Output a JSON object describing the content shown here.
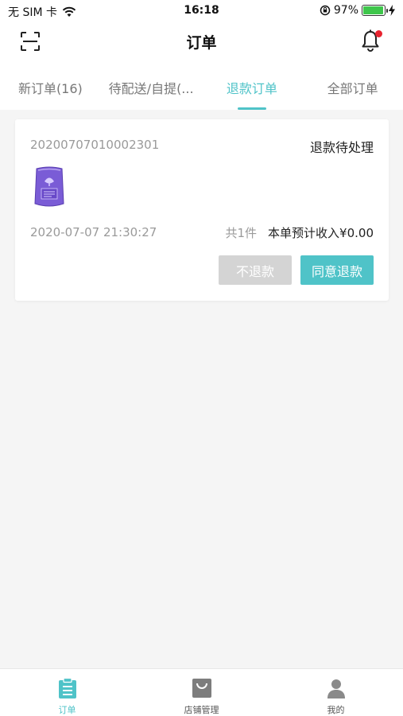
{
  "status_bar": {
    "carrier": "无 SIM 卡",
    "time": "16:18",
    "battery_percent_label": "97%",
    "battery_level": 0.97
  },
  "navbar": {
    "title": "订单"
  },
  "tabs": [
    {
      "label": "新订单(16)",
      "active": false
    },
    {
      "label": "待配送/自提(...",
      "active": false
    },
    {
      "label": "退款订单",
      "active": true
    },
    {
      "label": "全部订单",
      "active": false
    }
  ],
  "order": {
    "number": "20200707010002301",
    "status": "退款待处理",
    "time": "2020-07-07 21:30:27",
    "count": "共1件",
    "income": "本单预计收入¥0.00",
    "refuse_label": "不退款",
    "agree_label": "同意退款"
  },
  "bottom_tabs": [
    {
      "label": "订单",
      "icon": "clipboard-icon",
      "active": true
    },
    {
      "label": "店铺管理",
      "icon": "bag-icon",
      "active": false
    },
    {
      "label": "我的",
      "icon": "user-icon",
      "active": false
    }
  ],
  "colors": {
    "accent": "#4fc3c8",
    "notification_dot": "#e8232f",
    "refuse_button": "#d4d4d4"
  }
}
